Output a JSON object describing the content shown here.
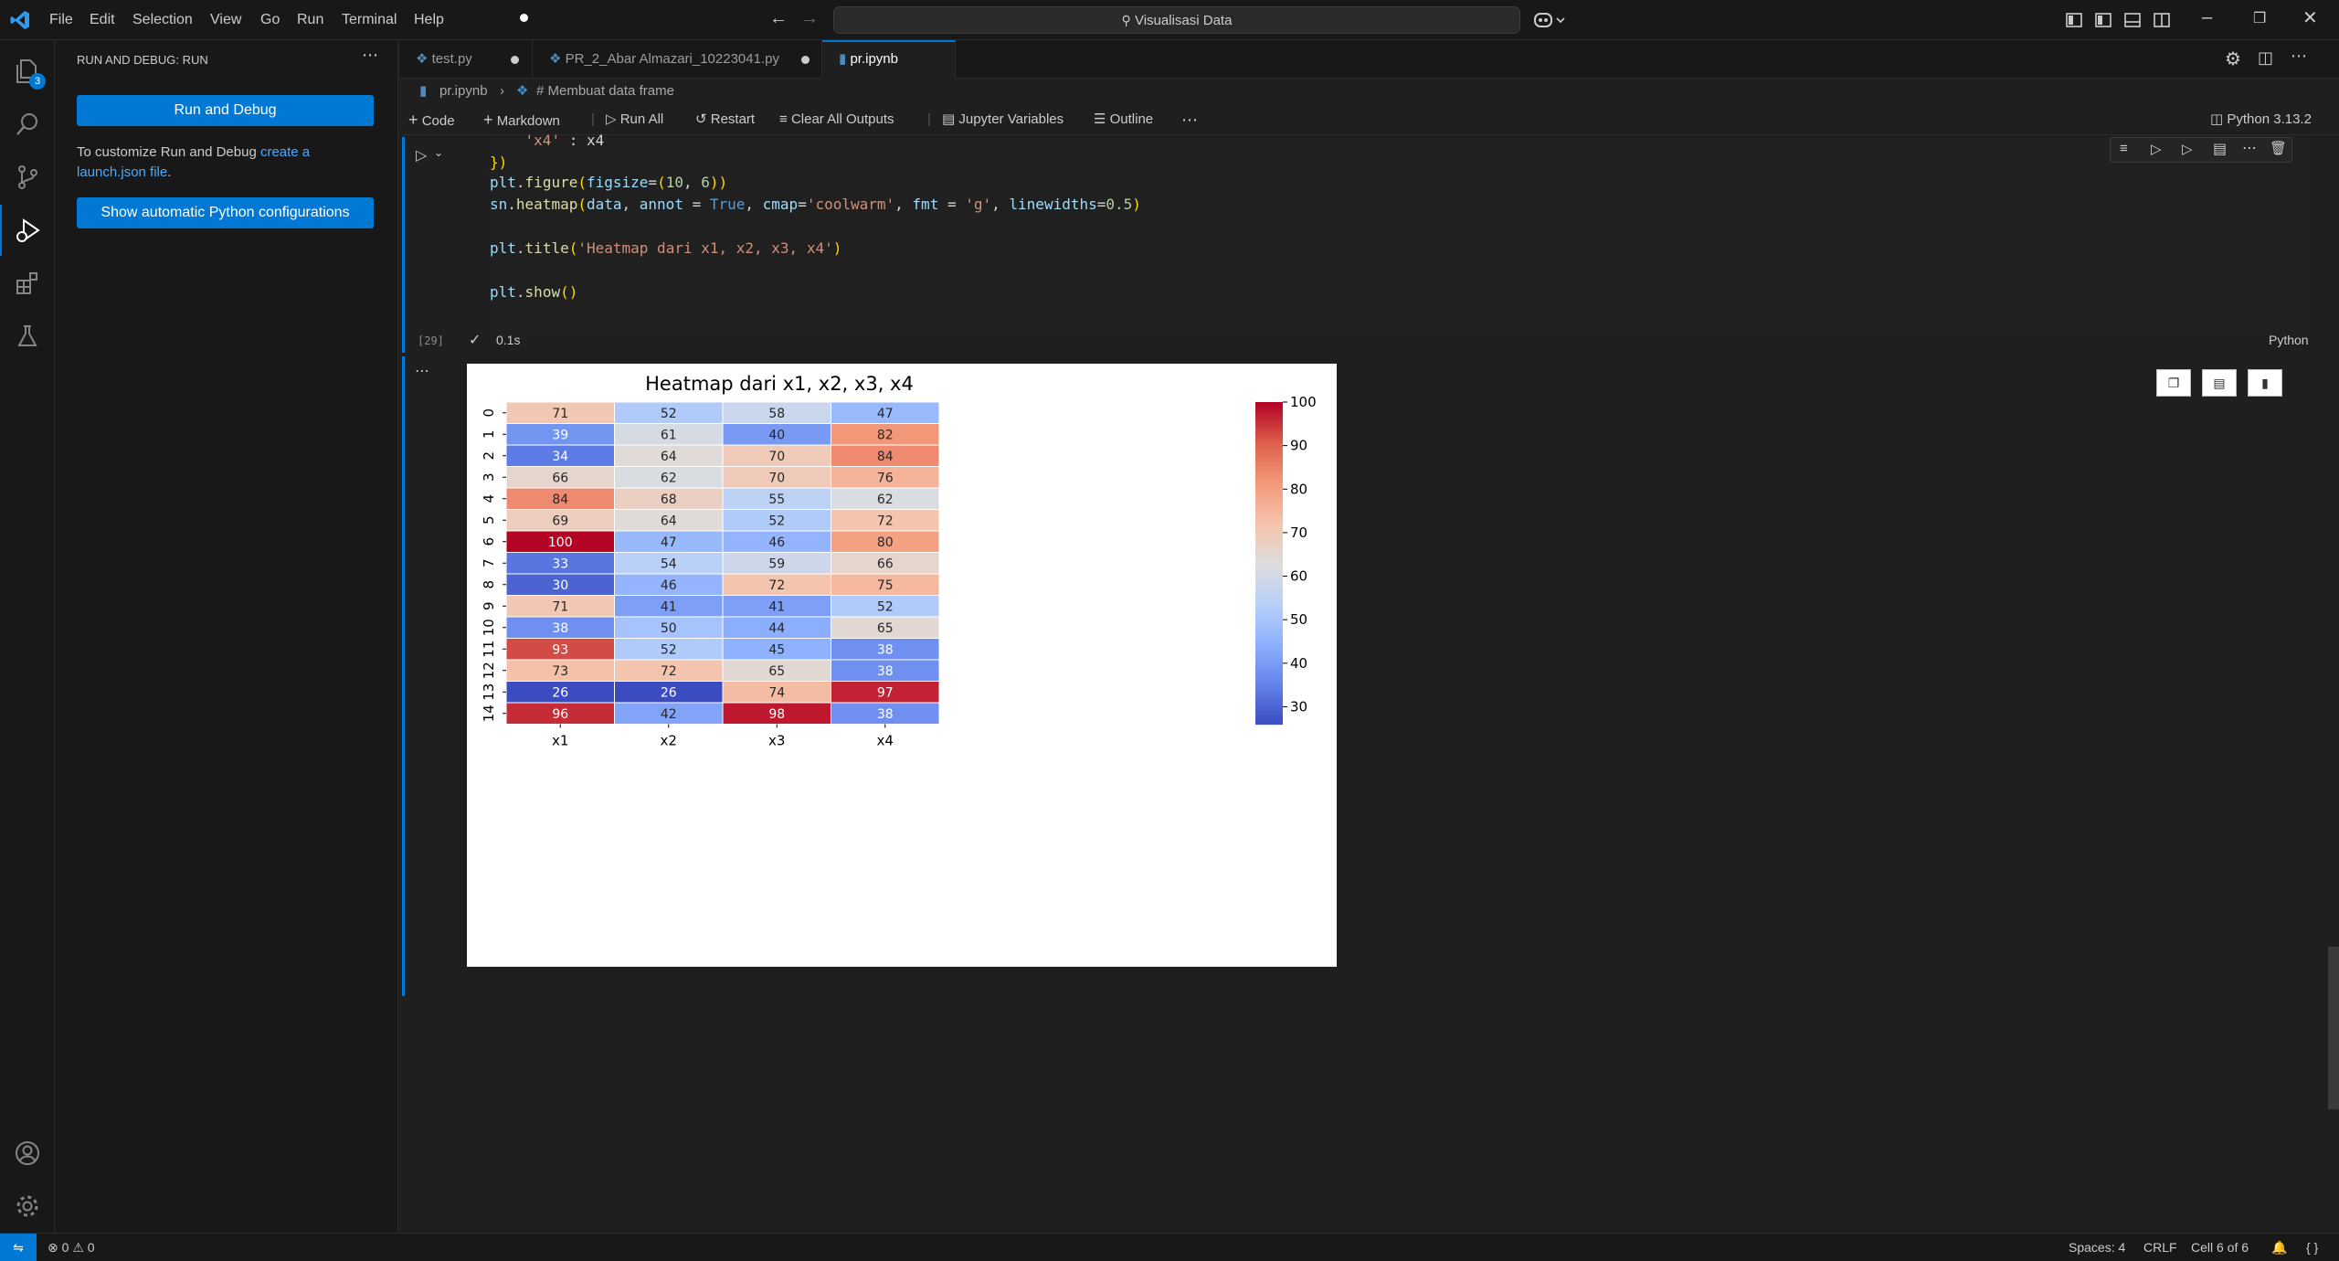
{
  "titlebar": {
    "menus": [
      "File",
      "Edit",
      "Selection",
      "View",
      "Go",
      "Run",
      "Terminal",
      "Help"
    ],
    "search_text": "Visualisasi Data"
  },
  "activity": {
    "explorer_badge": "3",
    "icons": [
      "explorer-icon",
      "search-icon",
      "source-control-icon",
      "run-debug-icon",
      "extensions-icon",
      "testing-icon",
      "account-icon",
      "manage-gear-icon"
    ]
  },
  "sidebar": {
    "title": "RUN AND DEBUG: RUN",
    "run_button": "Run and Debug",
    "customize_text": "To customize Run and Debug",
    "link1": "create a",
    "link2": "launch.json file",
    "period": ".",
    "python_button": "Show automatic Python configurations"
  },
  "tabs": [
    {
      "label": "test.py",
      "active": false
    },
    {
      "label": "PR_2_Abar Almazari_10223041.py",
      "active": false
    },
    {
      "label": "pr.ipynb",
      "active": true
    }
  ],
  "breadcrumb": {
    "file": "pr.ipynb",
    "section": "# Membuat data frame"
  },
  "notebook_toolbar": {
    "code": "Code",
    "markdown": "Markdown",
    "run_all": "Run All",
    "restart": "Restart",
    "clear": "Clear All Outputs",
    "variables": "Jupyter Variables",
    "outline": "Outline",
    "kernel": "Python 3.13.2"
  },
  "cell": {
    "exec_count": "[29]",
    "duration": "0.1s",
    "language": "Python"
  },
  "status": {
    "errors": "0",
    "warnings": "0",
    "spaces": "Spaces: 4",
    "eol": "CRLF",
    "cell": "Cell 6 of 6"
  },
  "chart_data": {
    "type": "heatmap",
    "title": "Heatmap dari x1, x2, x3, x4",
    "columns": [
      "x1",
      "x2",
      "x3",
      "x4"
    ],
    "rows": [
      "0",
      "1",
      "2",
      "3",
      "4",
      "5",
      "6",
      "7",
      "8",
      "9",
      "10",
      "11",
      "12",
      "13",
      "14"
    ],
    "values": [
      [
        71,
        52,
        58,
        47
      ],
      [
        39,
        61,
        40,
        82
      ],
      [
        34,
        64,
        70,
        84
      ],
      [
        66,
        62,
        70,
        76
      ],
      [
        84,
        68,
        55,
        62
      ],
      [
        69,
        64,
        52,
        72
      ],
      [
        100,
        47,
        46,
        80
      ],
      [
        33,
        54,
        59,
        66
      ],
      [
        30,
        46,
        72,
        75
      ],
      [
        71,
        41,
        41,
        52
      ],
      [
        38,
        50,
        44,
        65
      ],
      [
        93,
        52,
        45,
        38
      ],
      [
        73,
        72,
        65,
        38
      ],
      [
        26,
        26,
        74,
        97
      ],
      [
        96,
        42,
        98,
        38
      ]
    ],
    "colorbar_ticks": [
      100,
      90,
      80,
      70,
      60,
      50,
      40,
      30
    ],
    "vmin": 26,
    "vmax": 100,
    "colormap": "coolwarm"
  }
}
